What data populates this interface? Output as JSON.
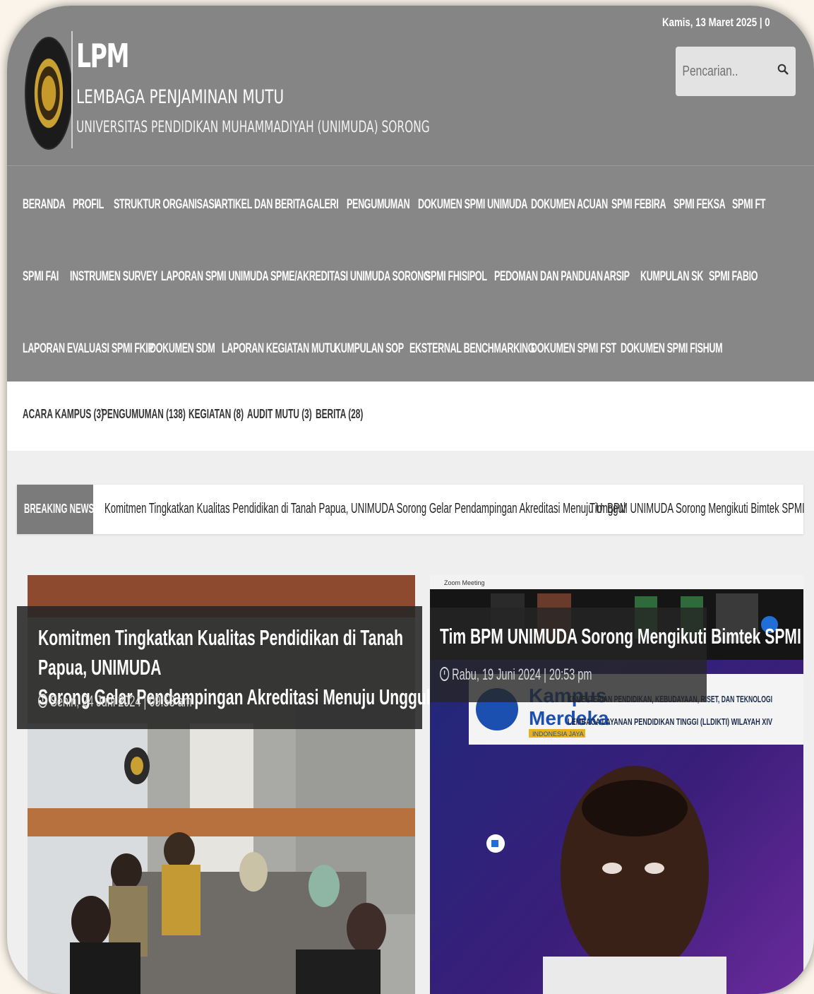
{
  "header": {
    "date": "Kamis, 13 Maret 2025 | 0",
    "brand_short": "LPM",
    "brand_long": "LEMBAGA PENJAMINAN MUTU",
    "university": "UNIVERSITAS PENDIDIKAN MUHAMMADIYAH (UNIMUDA) SORONG",
    "search_placeholder": "Pencarian.."
  },
  "nav": {
    "row1": [
      "BERANDA",
      "PROFIL",
      "STRUKTUR ORGANISASI",
      "ARTIKEL DAN BERITA",
      "GALERI",
      "PENGUMUMAN",
      "DOKUMEN SPMI UNIMUDA",
      "DOKUMEN ACUAN",
      "SPMI FEBIRA",
      "SPMI FEKSA",
      "SPMI FT"
    ],
    "row2": [
      "SPMI FAI",
      "INSTRUMEN SURVEY",
      "LAPORAN SPMI UNIMUDA",
      "SPME/AKREDITASI UNIMUDA SORONG",
      "SPMI FHISIPOL",
      "PEDOMAN DAN PANDUAN",
      "ARSIP",
      "KUMPULAN SK",
      "SPMI FABIO"
    ],
    "row3": [
      "LAPORAN EVALUASI SPMI FKIP",
      "DOKUMEN SDM",
      "LAPORAN KEGIATAN MUTU",
      "KUMPULAN SOP",
      "EKSTERNAL BENCHMARKING",
      "DOKUMEN SPMI FST",
      "DOKUMEN SPMI FISHUM"
    ]
  },
  "categories": [
    "ACARA KAMPUS (3)",
    "PENGUMUMAN (138)",
    "KEGIATAN (8)",
    "AUDIT MUTU (3)",
    "BERITA (28)"
  ],
  "breaking": {
    "label": "BREAKING NEWS",
    "items": [
      "Komitmen Tingkatkan Kualitas Pendidikan di Tanah Papua, UNIMUDA Sorong Gelar Pendampingan Akreditasi Menuju Unggul",
      "Tim BPM UNIMUDA Sorong Mengikuti Bimtek SPMI"
    ]
  },
  "posts": [
    {
      "title_line1": "Komitmen Tingkatkan Kualitas Pendidikan di Tanah Papua, UNIMUDA",
      "title_line2": "Sorong Gelar Pendampingan Akreditasi Menuju Unggul",
      "date": "Senin, 24 Juni 2024 | 09:53 am"
    },
    {
      "title": "Tim BPM UNIMUDA Sorong Mengikuti Bimtek SPMI",
      "date": "Rabu, 19 Juni 2024 | 20:53 pm",
      "zoom_title": "Zoom Meeting",
      "banner_line1": "Kampus",
      "banner_line2": "Merdeka",
      "banner_tag": "INDONESIA JAYA",
      "banner_text1": "KEMENTERIAN PENDIDIKAN, KEBUDAYAAN, RISET, DAN TEKNOLOGI",
      "banner_text2": "LEMBAGA LAYANAN PENDIDIKAN TINGGI (LLDIKTI) WILAYAH XIV"
    }
  ],
  "colors": {
    "header_bg": "#858585",
    "breaking_label_bg": "#7b7b7b",
    "page_bg": "#efefef"
  }
}
